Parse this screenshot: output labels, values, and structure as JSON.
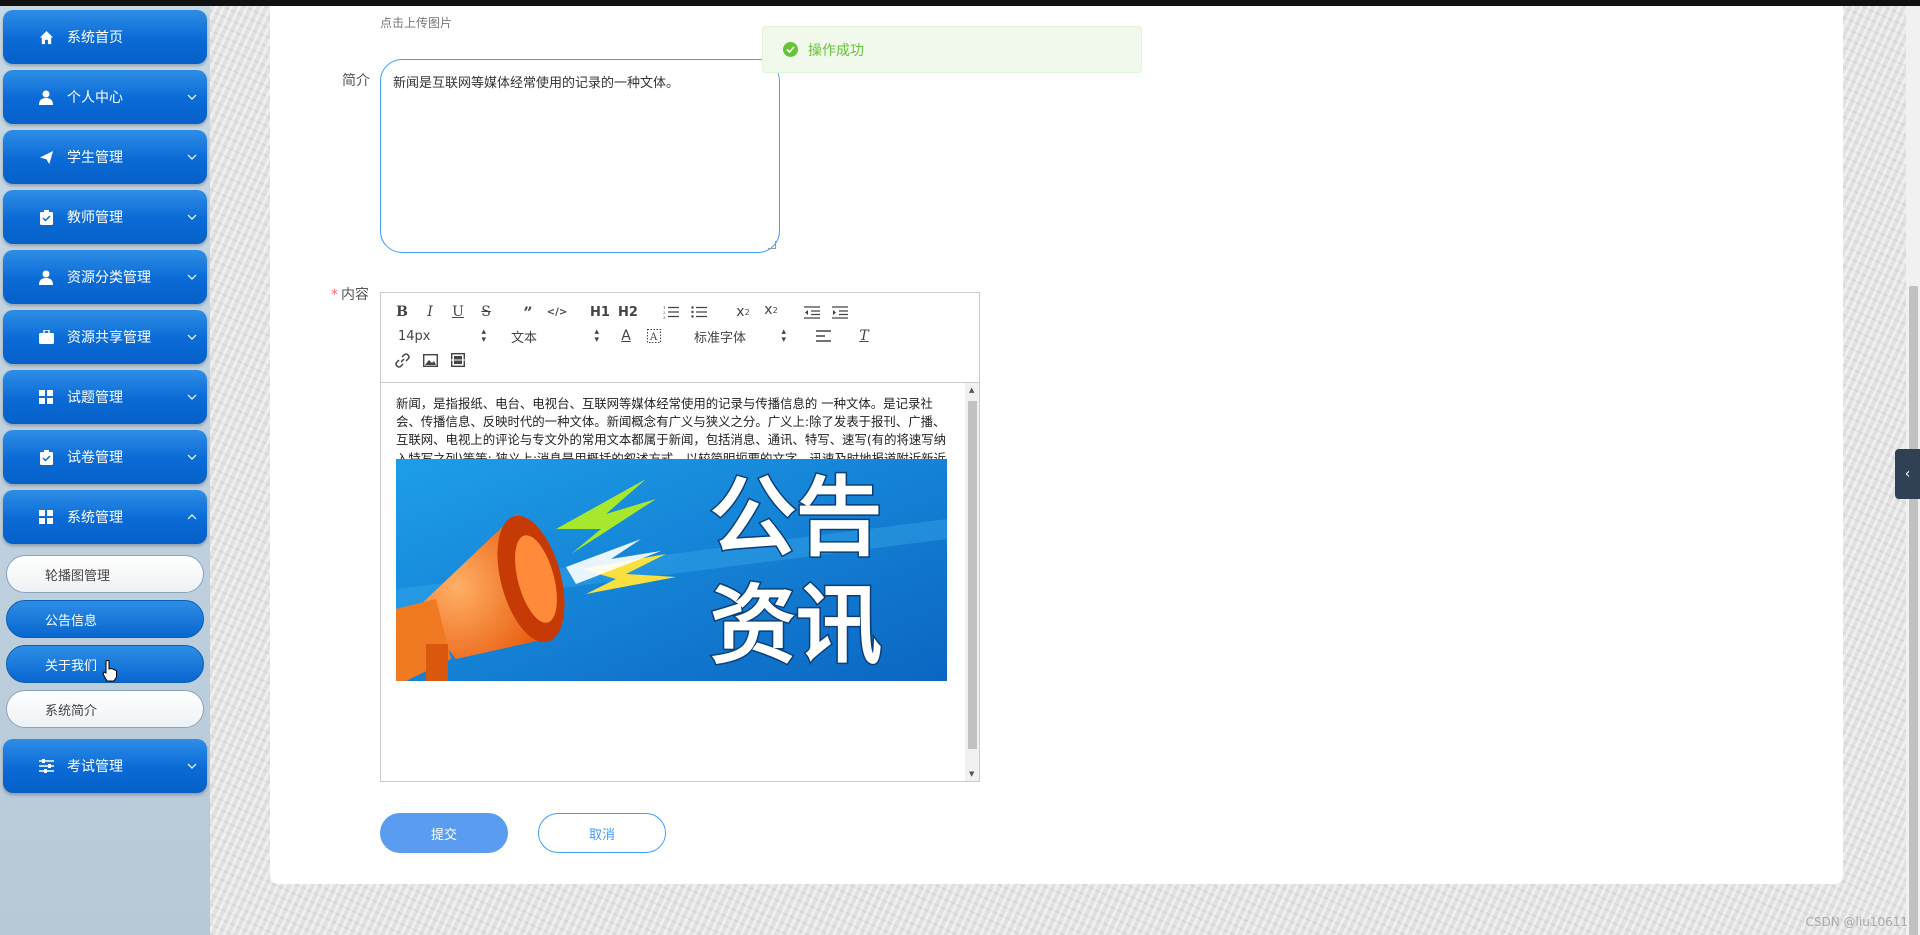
{
  "sidebar": {
    "menu": [
      {
        "label": "系统首页",
        "icon": "home-icon"
      },
      {
        "label": "个人中心",
        "icon": "user-icon"
      },
      {
        "label": "学生管理",
        "icon": "send-icon"
      },
      {
        "label": "教师管理",
        "icon": "clipboard-icon"
      },
      {
        "label": "资源分类管理",
        "icon": "user-icon"
      },
      {
        "label": "资源共享管理",
        "icon": "briefcase-icon"
      },
      {
        "label": "试题管理",
        "icon": "grid-icon"
      },
      {
        "label": "试卷管理",
        "icon": "clipboard-check-icon"
      },
      {
        "label": "系统管理",
        "icon": "grid-icon"
      }
    ],
    "submenu": [
      "轮播图管理",
      "公告信息",
      "关于我们",
      "系统简介"
    ],
    "last_menu": {
      "label": "考试管理",
      "icon": "sliders-icon"
    }
  },
  "form": {
    "upload_hint": "点击上传图片",
    "summary_label": "简介",
    "summary_value": "新闻是互联网等媒体经常使用的记录的一种文体。",
    "content_label": "内容",
    "content_text": "新闻，是指报纸、电台、电视台、互联网等媒体经常使用的记录与传播信息的 一种文体。是记录社会、传播信息、反映时代的一种文体。新闻概念有广义与狭义之分。广义上:除了发表于报刊、广播、互联网、电视上的评论与专文外的常用文本都属于新闻，包括消息、通讯、特写、速写(有的将速写纳入特写之列)等等; 狭义上:消息是用概括的叙述方式，以较简明扼要的文字，迅速及时地报道附近新近发生的、有价值的事实，使一定人群了解。新闻一般包括标题、导语、主体、背景和结语五部分。前三者是主要部分，后二者是辅助部分。写法以叙述为主兼或有议论、描写、评论等。新闻是包含海量资讯的新闻服务平台,真实反映每时每刻的重要事件。您可以搜索新闻事件、热点话题、人物动态、产品资讯等,快速了解它们的最新进展。",
    "banner_line1": "公告",
    "banner_line2": "资讯",
    "submit_label": "提交",
    "cancel_label": "取消"
  },
  "editor_toolbar": {
    "font_size": "14px",
    "paragraph": "文本",
    "font_family": "标准字体",
    "h1": "H1",
    "h2": "H2",
    "bold": "B",
    "italic": "I",
    "underline": "U",
    "strike": "S"
  },
  "toast": {
    "message": "操作成功"
  },
  "watermark": "CSDN @liu10611",
  "colors": {
    "menu_blue": "#0a6ad6",
    "accent": "#409eff",
    "success": "#67c23a"
  }
}
